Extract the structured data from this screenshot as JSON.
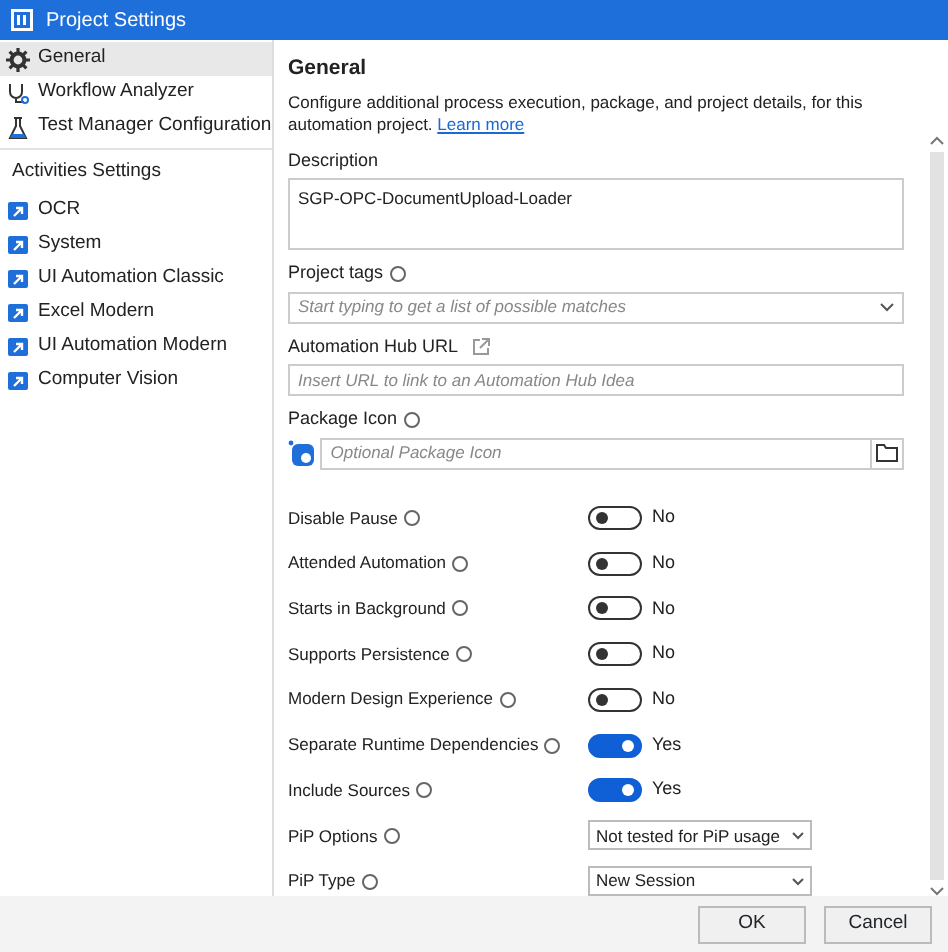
{
  "window": {
    "title": "Project Settings"
  },
  "sidebar": {
    "items": [
      {
        "label": "General",
        "selected": true,
        "kind": "gear"
      },
      {
        "label": "Workflow Analyzer",
        "selected": false,
        "kind": "analyzer"
      },
      {
        "label": "Test Manager Configuration",
        "selected": false,
        "kind": "flask"
      }
    ],
    "section": {
      "title": "Activities Settings",
      "items": [
        {
          "label": "OCR",
          "selected": false,
          "kind": "activity"
        },
        {
          "label": "System",
          "selected": false,
          "kind": "activity"
        },
        {
          "label": "UI Automation Classic",
          "selected": false,
          "kind": "activity"
        },
        {
          "label": "Excel Modern",
          "selected": false,
          "kind": "activity"
        },
        {
          "label": "UI Automation Modern",
          "selected": false,
          "kind": "activity"
        },
        {
          "label": "Computer Vision",
          "selected": false,
          "kind": "activity"
        }
      ]
    }
  },
  "main": {
    "heading": "General",
    "intro": "Configure additional process execution, package, and project details, for this automation project.",
    "intro_link": "Learn more",
    "description": {
      "label": "Description",
      "value": "SGP-OPC-DocumentUpload-Loader"
    },
    "project_tags": {
      "label": "Project tags",
      "placeholder": "Start typing to get a list of possible matches"
    },
    "hub_url": {
      "label": "Automation Hub URL",
      "placeholder": "Insert URL to link to an Automation Hub Idea"
    },
    "package_icon": {
      "label": "Package Icon",
      "placeholder": "Optional Package Icon"
    },
    "toggles": [
      {
        "label": "Disable Pause",
        "on": false,
        "value_text": "No"
      },
      {
        "label": "Attended Automation",
        "on": false,
        "value_text": "No"
      },
      {
        "label": "Starts in Background",
        "on": false,
        "value_text": "No"
      },
      {
        "label": "Supports Persistence",
        "on": false,
        "value_text": "No"
      },
      {
        "label": "Modern Design Experience",
        "on": false,
        "value_text": "No"
      },
      {
        "label": "Separate Runtime Dependencies",
        "on": true,
        "value_text": "Yes"
      },
      {
        "label": "Include Sources",
        "on": true,
        "value_text": "Yes"
      }
    ],
    "dropdowns": [
      {
        "label": "PiP Options",
        "value": "Not tested for PiP usage"
      },
      {
        "label": "PiP Type",
        "value": "New Session"
      }
    ]
  },
  "buttons": [
    "OK",
    "Cancel"
  ]
}
